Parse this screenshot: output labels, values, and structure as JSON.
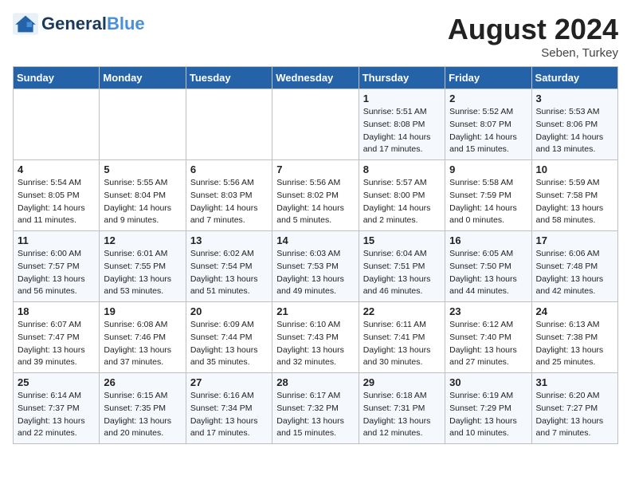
{
  "header": {
    "logo_general": "General",
    "logo_blue": "Blue",
    "month_title": "August 2024",
    "subtitle": "Seben, Turkey"
  },
  "weekdays": [
    "Sunday",
    "Monday",
    "Tuesday",
    "Wednesday",
    "Thursday",
    "Friday",
    "Saturday"
  ],
  "weeks": [
    [
      {
        "day": "",
        "sunrise": "",
        "sunset": "",
        "daylight": ""
      },
      {
        "day": "",
        "sunrise": "",
        "sunset": "",
        "daylight": ""
      },
      {
        "day": "",
        "sunrise": "",
        "sunset": "",
        "daylight": ""
      },
      {
        "day": "",
        "sunrise": "",
        "sunset": "",
        "daylight": ""
      },
      {
        "day": "1",
        "sunrise": "Sunrise: 5:51 AM",
        "sunset": "Sunset: 8:08 PM",
        "daylight": "Daylight: 14 hours and 17 minutes."
      },
      {
        "day": "2",
        "sunrise": "Sunrise: 5:52 AM",
        "sunset": "Sunset: 8:07 PM",
        "daylight": "Daylight: 14 hours and 15 minutes."
      },
      {
        "day": "3",
        "sunrise": "Sunrise: 5:53 AM",
        "sunset": "Sunset: 8:06 PM",
        "daylight": "Daylight: 14 hours and 13 minutes."
      }
    ],
    [
      {
        "day": "4",
        "sunrise": "Sunrise: 5:54 AM",
        "sunset": "Sunset: 8:05 PM",
        "daylight": "Daylight: 14 hours and 11 minutes."
      },
      {
        "day": "5",
        "sunrise": "Sunrise: 5:55 AM",
        "sunset": "Sunset: 8:04 PM",
        "daylight": "Daylight: 14 hours and 9 minutes."
      },
      {
        "day": "6",
        "sunrise": "Sunrise: 5:56 AM",
        "sunset": "Sunset: 8:03 PM",
        "daylight": "Daylight: 14 hours and 7 minutes."
      },
      {
        "day": "7",
        "sunrise": "Sunrise: 5:56 AM",
        "sunset": "Sunset: 8:02 PM",
        "daylight": "Daylight: 14 hours and 5 minutes."
      },
      {
        "day": "8",
        "sunrise": "Sunrise: 5:57 AM",
        "sunset": "Sunset: 8:00 PM",
        "daylight": "Daylight: 14 hours and 2 minutes."
      },
      {
        "day": "9",
        "sunrise": "Sunrise: 5:58 AM",
        "sunset": "Sunset: 7:59 PM",
        "daylight": "Daylight: 14 hours and 0 minutes."
      },
      {
        "day": "10",
        "sunrise": "Sunrise: 5:59 AM",
        "sunset": "Sunset: 7:58 PM",
        "daylight": "Daylight: 13 hours and 58 minutes."
      }
    ],
    [
      {
        "day": "11",
        "sunrise": "Sunrise: 6:00 AM",
        "sunset": "Sunset: 7:57 PM",
        "daylight": "Daylight: 13 hours and 56 minutes."
      },
      {
        "day": "12",
        "sunrise": "Sunrise: 6:01 AM",
        "sunset": "Sunset: 7:55 PM",
        "daylight": "Daylight: 13 hours and 53 minutes."
      },
      {
        "day": "13",
        "sunrise": "Sunrise: 6:02 AM",
        "sunset": "Sunset: 7:54 PM",
        "daylight": "Daylight: 13 hours and 51 minutes."
      },
      {
        "day": "14",
        "sunrise": "Sunrise: 6:03 AM",
        "sunset": "Sunset: 7:53 PM",
        "daylight": "Daylight: 13 hours and 49 minutes."
      },
      {
        "day": "15",
        "sunrise": "Sunrise: 6:04 AM",
        "sunset": "Sunset: 7:51 PM",
        "daylight": "Daylight: 13 hours and 46 minutes."
      },
      {
        "day": "16",
        "sunrise": "Sunrise: 6:05 AM",
        "sunset": "Sunset: 7:50 PM",
        "daylight": "Daylight: 13 hours and 44 minutes."
      },
      {
        "day": "17",
        "sunrise": "Sunrise: 6:06 AM",
        "sunset": "Sunset: 7:48 PM",
        "daylight": "Daylight: 13 hours and 42 minutes."
      }
    ],
    [
      {
        "day": "18",
        "sunrise": "Sunrise: 6:07 AM",
        "sunset": "Sunset: 7:47 PM",
        "daylight": "Daylight: 13 hours and 39 minutes."
      },
      {
        "day": "19",
        "sunrise": "Sunrise: 6:08 AM",
        "sunset": "Sunset: 7:46 PM",
        "daylight": "Daylight: 13 hours and 37 minutes."
      },
      {
        "day": "20",
        "sunrise": "Sunrise: 6:09 AM",
        "sunset": "Sunset: 7:44 PM",
        "daylight": "Daylight: 13 hours and 35 minutes."
      },
      {
        "day": "21",
        "sunrise": "Sunrise: 6:10 AM",
        "sunset": "Sunset: 7:43 PM",
        "daylight": "Daylight: 13 hours and 32 minutes."
      },
      {
        "day": "22",
        "sunrise": "Sunrise: 6:11 AM",
        "sunset": "Sunset: 7:41 PM",
        "daylight": "Daylight: 13 hours and 30 minutes."
      },
      {
        "day": "23",
        "sunrise": "Sunrise: 6:12 AM",
        "sunset": "Sunset: 7:40 PM",
        "daylight": "Daylight: 13 hours and 27 minutes."
      },
      {
        "day": "24",
        "sunrise": "Sunrise: 6:13 AM",
        "sunset": "Sunset: 7:38 PM",
        "daylight": "Daylight: 13 hours and 25 minutes."
      }
    ],
    [
      {
        "day": "25",
        "sunrise": "Sunrise: 6:14 AM",
        "sunset": "Sunset: 7:37 PM",
        "daylight": "Daylight: 13 hours and 22 minutes."
      },
      {
        "day": "26",
        "sunrise": "Sunrise: 6:15 AM",
        "sunset": "Sunset: 7:35 PM",
        "daylight": "Daylight: 13 hours and 20 minutes."
      },
      {
        "day": "27",
        "sunrise": "Sunrise: 6:16 AM",
        "sunset": "Sunset: 7:34 PM",
        "daylight": "Daylight: 13 hours and 17 minutes."
      },
      {
        "day": "28",
        "sunrise": "Sunrise: 6:17 AM",
        "sunset": "Sunset: 7:32 PM",
        "daylight": "Daylight: 13 hours and 15 minutes."
      },
      {
        "day": "29",
        "sunrise": "Sunrise: 6:18 AM",
        "sunset": "Sunset: 7:31 PM",
        "daylight": "Daylight: 13 hours and 12 minutes."
      },
      {
        "day": "30",
        "sunrise": "Sunrise: 6:19 AM",
        "sunset": "Sunset: 7:29 PM",
        "daylight": "Daylight: 13 hours and 10 minutes."
      },
      {
        "day": "31",
        "sunrise": "Sunrise: 6:20 AM",
        "sunset": "Sunset: 7:27 PM",
        "daylight": "Daylight: 13 hours and 7 minutes."
      }
    ]
  ]
}
